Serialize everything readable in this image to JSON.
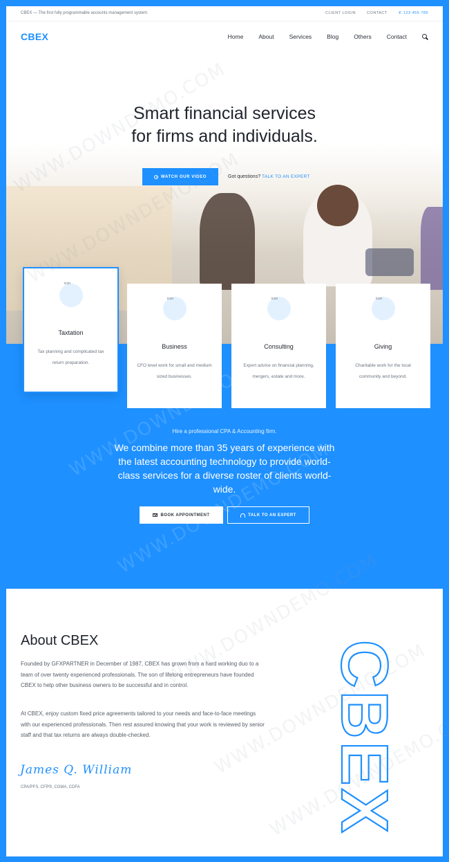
{
  "topbar": {
    "tagline": "CBEX — The first fully programmable accounts management system",
    "client_login": "CLIENT LOGIN",
    "contact": "CONTACT",
    "phone": "123 456 789"
  },
  "nav": {
    "logo": "CBEX",
    "items": [
      "Home",
      "About",
      "Services",
      "Blog",
      "Others",
      "Contact"
    ]
  },
  "hero": {
    "title_line1": "Smart financial services",
    "title_line2": "for firms and individuals.",
    "video_button": "WATCH OUR VIDEO",
    "question": "Got questions?",
    "expert_link": "TALK TO AN EXPERT"
  },
  "services": [
    {
      "icon_alt": "icon",
      "title": "Taxtation",
      "desc": "Tax planning and complicated tax return preparation."
    },
    {
      "icon_alt": "icon",
      "title": "Business",
      "desc": "CFO level work for small and medium sized businesses."
    },
    {
      "icon_alt": "icon",
      "title": "Consulting",
      "desc": "Expert advice on financial planning, mergers, estate and more."
    },
    {
      "icon_alt": "icon",
      "title": "Giving",
      "desc": "Charitable work for the local community and beyond."
    }
  ],
  "cta": {
    "subtitle": "Hire a professional CPA & Accounting firm.",
    "text": "We combine more than 35 years of experience with the latest accounting technology to provide world-class services for a diverse roster of clients world-wide.",
    "book_button": "BOOK APPOINTMENT",
    "expert_button": "TALK TO AN EXPERT"
  },
  "about": {
    "title": "About CBEX",
    "para1": "Founded by GFXPARTNER in December of 1987, CBEX has grown from a hard working duo to a team of over twenty experienced professionals. The son of lifelong entrepreneurs have founded CBEX to help other business owners to be successful and in control.",
    "para2": "At CBEX, enjoy custom fixed price agreements tailored to your needs and face-to-face meetings with our experienced professionals. Then rest assured knowing that your work is reviewed by senior staff and that tax returns are always double-checked.",
    "signature": "James Q. William",
    "credentials": "CPA/PFS, CFP®, CGMA, CDFA",
    "outline_text": "CBEX"
  },
  "watermark": "WWW.DOWNDEMO.COM",
  "colors": {
    "accent": "#1e90ff",
    "text_dark": "#1f232b",
    "text_muted": "#6b7480"
  }
}
